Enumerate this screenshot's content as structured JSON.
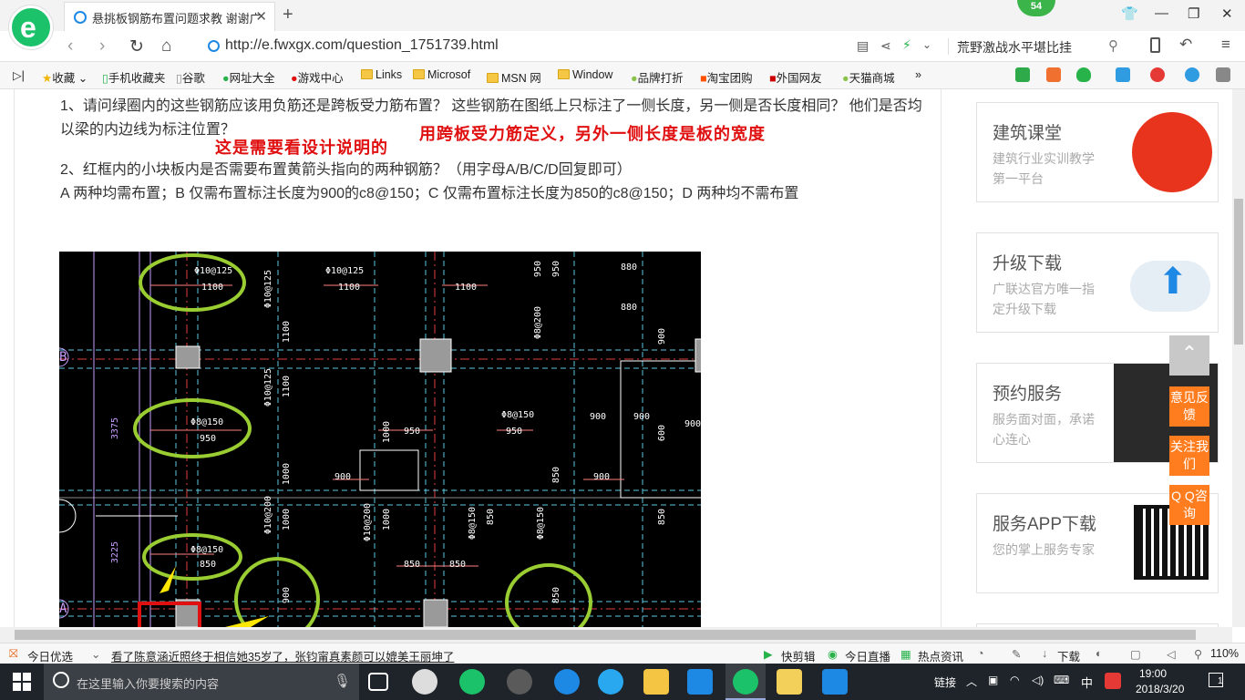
{
  "browser": {
    "tab_title": "悬挑板钢筋布置问题求教 谢谢广",
    "badge": "54",
    "url": "http://e.fwxgx.com/question_1751739.html",
    "search_text": "荒野激战水平堪比挂",
    "bookmarks": [
      "收藏",
      "手机收藏夹",
      "谷歌",
      "网址大全",
      "游戏中心",
      "Links",
      "Microsof",
      "MSN 网",
      "Window",
      "品牌打折",
      "淘宝团购",
      "外国网友",
      "天猫商城"
    ]
  },
  "article": {
    "q1": "1、请问绿圈内的这些钢筋应该用负筋还是跨板受力筋布置？ 这些钢筋在图纸上只标注了一侧长度，另一侧是否长度相同？ 他们是否均以梁的内边线为标注位置？",
    "q1_answer": "用跨板受力筋定义，另外一侧长度是板的宽度",
    "q1_note": "这是需要看设计说明的",
    "q2": "2、红框内的小块板内是否需要布置黄箭头指向的两种钢筋？（用字母A/B/C/D回复即可）",
    "q2_options": "A  两种均需布置；B  仅需布置标注长度为900的c8@150；C  仅需布置标注长度为850的c8@150；D  两种均不需布置"
  },
  "drawing": {
    "labels": [
      "Φ10@125",
      "1100",
      "Φ10@125",
      "1100",
      "1100",
      "Φ8@150",
      "950",
      "950",
      "950",
      "Φ8@150",
      "850",
      "850",
      "850",
      "900",
      "900",
      "900",
      "900",
      "900",
      "880",
      "880",
      "3375",
      "3225",
      "B",
      "A",
      "Φ8@150",
      "Φ8@150",
      "Φ8@150",
      "Φ10@200",
      "Φ10@200",
      "Φ8@200",
      "Φ10@125",
      "Φ10@125",
      "1100",
      "1100",
      "1000",
      "1000",
      "1000",
      "1000",
      "850",
      "850",
      "850",
      "900",
      "900",
      "950",
      "950",
      "600",
      "850"
    ]
  },
  "sidebar": {
    "cards": [
      {
        "title": "建筑课堂",
        "sub": "建筑行业实训教学第一平台"
      },
      {
        "title": "升级下载",
        "sub": "广联达官方唯一指定升级下载"
      },
      {
        "title": "预约服务",
        "sub": "服务面对面，承诺心连心"
      },
      {
        "title": "服务APP下载",
        "sub": "您的掌上服务专家"
      }
    ],
    "float": [
      "意见反馈",
      "关注我们",
      "Q Q咨询"
    ]
  },
  "statusbar": {
    "today": "今日优选",
    "news": "看了陈意涵近照终于相信她35岁了，张钧甯真素颜可以媲美王丽坤了",
    "items": [
      "快剪辑",
      "今日直播",
      "热点资讯",
      "下载",
      "110%"
    ]
  },
  "taskbar": {
    "search_placeholder": "在这里输入你要搜索的内容",
    "link": "链接",
    "ime": "中",
    "time": "19:00",
    "date": "2018/3/20",
    "notif": "1"
  }
}
